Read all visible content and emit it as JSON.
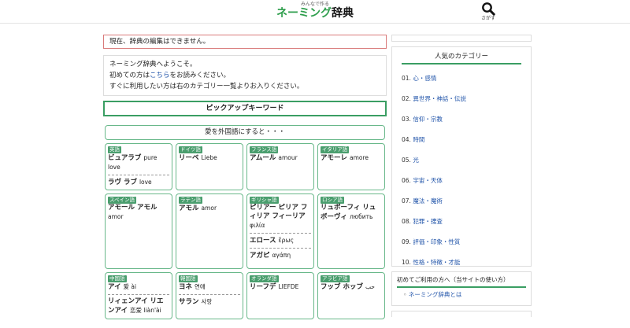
{
  "header": {
    "logo_sub": "みんなで作る",
    "logo_green": "ネーミング",
    "logo_black": "辞典",
    "search_label": "さがす",
    "search_icon": "magnifier-icon"
  },
  "notice": "現在、辞典の編集はできません。",
  "welcome": {
    "line1": "ネーミング辞典へようこそ。",
    "line2_pre": "初めての方は",
    "line2_link": "こちら",
    "line2_post": "をお読みください。",
    "line3": "すぐに利用したい方は右のカテゴリー一覧よりお入りください。"
  },
  "pickup_title": "ピックアップキーワード",
  "intro": "愛を外国語にすると・・・",
  "languages": [
    {
      "tag": "英語",
      "entries": [
        {
          "word": "ビュアラブ",
          "orig": "pure love"
        },
        {
          "word": "ラヴ ラブ",
          "orig": "love"
        }
      ]
    },
    {
      "tag": "ドイツ語",
      "entries": [
        {
          "word": "リーベ",
          "orig": "Liebe"
        }
      ]
    },
    {
      "tag": "フランス語",
      "entries": [
        {
          "word": "アムール",
          "orig": "amour"
        }
      ]
    },
    {
      "tag": "イタリア語",
      "entries": [
        {
          "word": "アモーレ",
          "orig": "amore"
        }
      ]
    },
    {
      "tag": "スペイン語",
      "entries": [
        {
          "word": "アモール アモル",
          "orig": "amor"
        }
      ]
    },
    {
      "tag": "ラテン語",
      "entries": [
        {
          "word": "アモル",
          "orig": "amor"
        }
      ]
    },
    {
      "tag": "ギリシャ語",
      "entries": [
        {
          "word": "ピリアー ピリア フィリア フィーリア",
          "orig": "φιλία"
        },
        {
          "word": "エロース",
          "orig": "ἔρως"
        },
        {
          "word": "アガピ",
          "orig": "αγάπη"
        }
      ]
    },
    {
      "tag": "ロシア語",
      "entries": [
        {
          "word": "リュボーフィ リュボーヴィ",
          "orig": "любить"
        }
      ]
    },
    {
      "tag": "中国語",
      "entries": [
        {
          "word": "アイ",
          "orig": "爱 ài"
        },
        {
          "word": "リィェンアイ リエンアイ",
          "orig": "恋爱 liàn'ài"
        }
      ]
    },
    {
      "tag": "韓国語",
      "entries": [
        {
          "word": "ヨネ",
          "orig": "연애"
        },
        {
          "word": "サラン",
          "orig": "사랑"
        }
      ]
    },
    {
      "tag": "オランダ語",
      "entries": [
        {
          "word": "リーフデ",
          "orig": "LIEFDE"
        }
      ]
    },
    {
      "tag": "アラビア語",
      "entries": [
        {
          "word": "フッブ ホッブ",
          "orig": "حب"
        }
      ]
    }
  ],
  "sidebar": {
    "category_title": "人気のカテゴリー",
    "categories": [
      {
        "num": "01.",
        "label": "心・感情"
      },
      {
        "num": "02.",
        "label": "異世界・神話・伝説"
      },
      {
        "num": "03.",
        "label": "信仰・宗教"
      },
      {
        "num": "04.",
        "label": "時間"
      },
      {
        "num": "05.",
        "label": "光"
      },
      {
        "num": "06.",
        "label": "宇宙・天体"
      },
      {
        "num": "07.",
        "label": "魔法・魔術"
      },
      {
        "num": "08.",
        "label": "犯罪・捜査"
      },
      {
        "num": "09.",
        "label": "評価・印象・性質"
      },
      {
        "num": "10.",
        "label": "性格・特徴・才能"
      }
    ],
    "guide_title": "初めてご利用の方へ（当サイトの使い方）",
    "guide_bullet": "◦",
    "guide_item": "ネーミング辞典とは"
  },
  "colors": {
    "accent_green": "#3a9e63",
    "tag_green": "#4a9e6e",
    "link_blue": "#2255aa",
    "notice_border": "#d97a7a"
  }
}
